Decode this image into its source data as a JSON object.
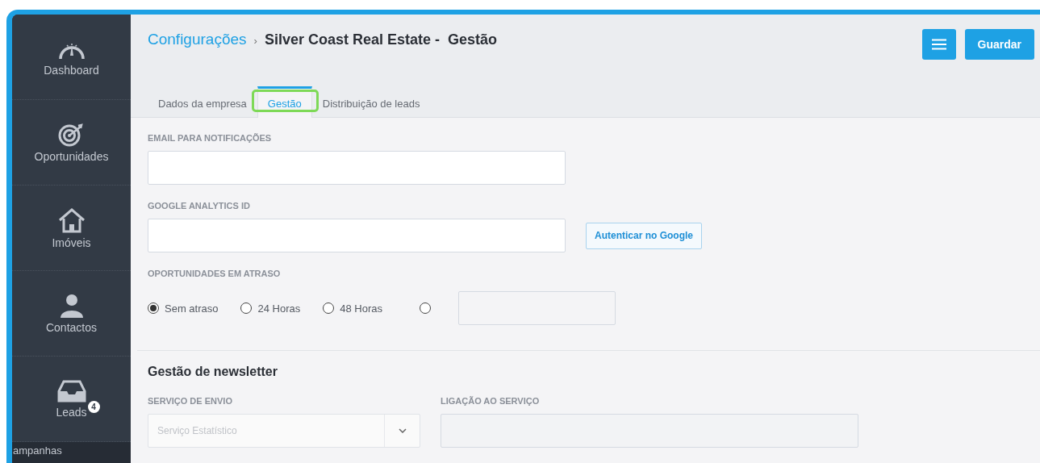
{
  "sidebar": {
    "items": [
      {
        "label": "Dashboard",
        "kind": "gauge",
        "selected": false
      },
      {
        "label": "Oportunidades",
        "kind": "target",
        "selected": false
      },
      {
        "label": "Imóveis",
        "kind": "house",
        "selected": false
      },
      {
        "label": "Contactos",
        "kind": "person",
        "selected": false
      },
      {
        "label": "Leads",
        "kind": "inbox",
        "selected": false,
        "badge": "4"
      }
    ],
    "cut_item": "ampanhas"
  },
  "breadcrumb": {
    "parent": "Configurações",
    "separator": "›",
    "current": "Silver Coast Real Estate -  Gestão"
  },
  "actions": {
    "save": "Guardar"
  },
  "tabs": [
    {
      "label": "Dados da empresa",
      "selected": false,
      "highlighted": false
    },
    {
      "label": "Gestão",
      "selected": true,
      "highlighted": true
    },
    {
      "label": "Distribuição de leads",
      "selected": false,
      "highlighted": false
    }
  ],
  "email_field": {
    "label": "EMAIL PARA NOTIFICAÇÕES"
  },
  "analytics_field": {
    "label": "GOOGLE ANALYTICS ID",
    "button": "Autenticar no Google"
  },
  "delay": {
    "label": "OPORTUNIDADES EM ATRASO",
    "options": [
      {
        "kind": "labeled",
        "label": "Sem atraso",
        "selected": true
      },
      {
        "kind": "labeled",
        "label": "24 Horas",
        "selected": false
      },
      {
        "kind": "labeled",
        "label": "48 Horas",
        "selected": false
      },
      {
        "kind": "custom",
        "selected": false
      }
    ]
  },
  "newsletter": {
    "title": "Gestão de newsletter",
    "service_label": "SERVIÇO DE ENVIO",
    "service_value": "Serviço Estatístico",
    "link_label": "LIGAÇÃO AO SERVIÇO"
  }
}
